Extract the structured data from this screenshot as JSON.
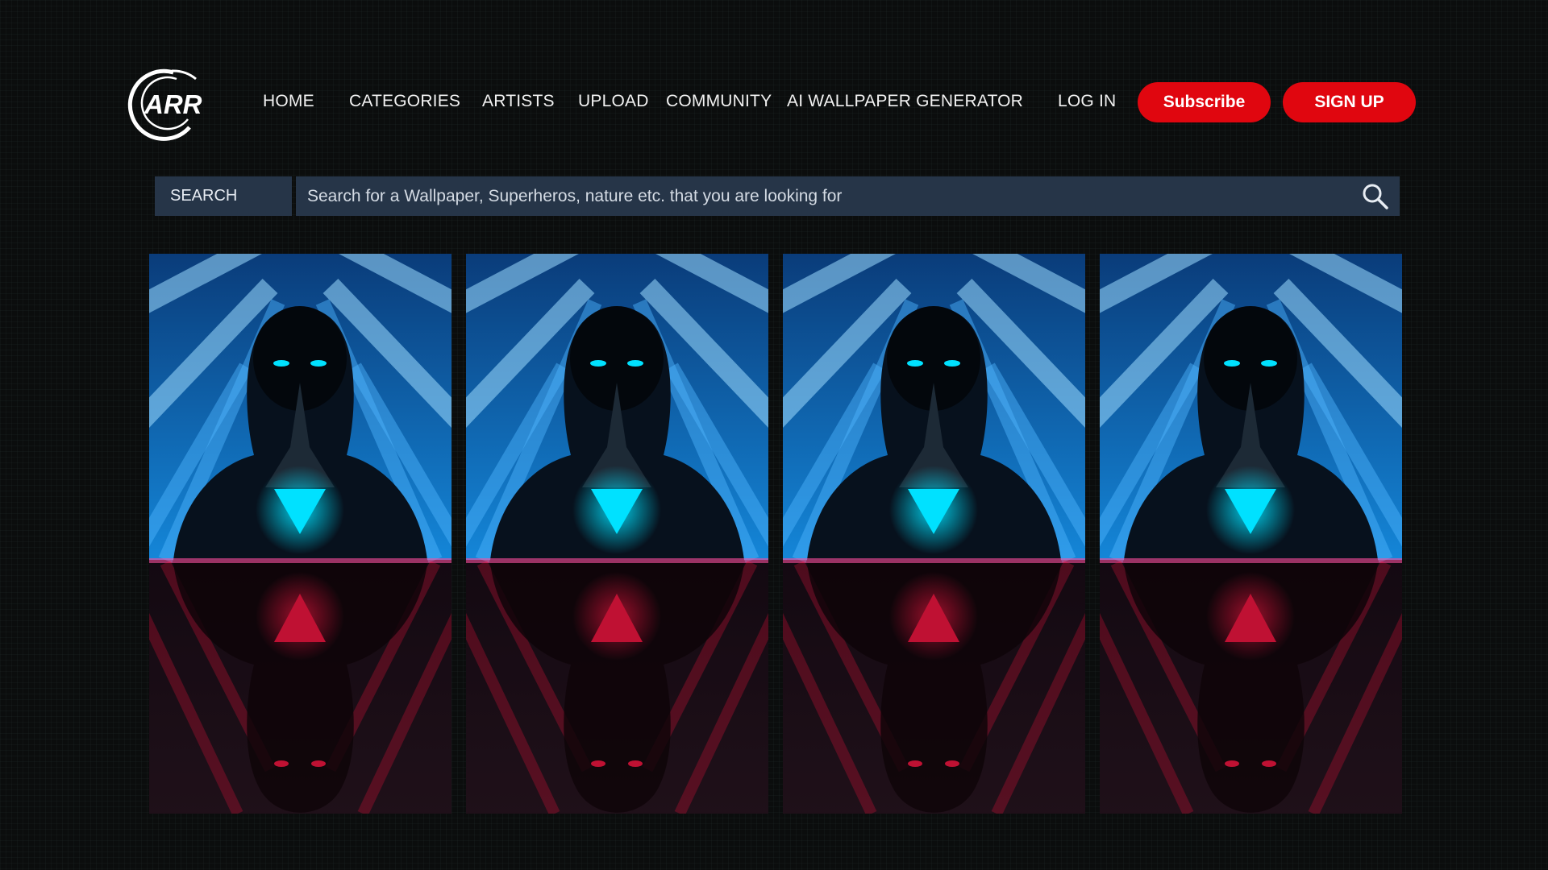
{
  "brand": {
    "logo_text": "ARR",
    "logo_icon": "ring-logo-icon"
  },
  "nav": {
    "items": [
      {
        "label": "HOME"
      },
      {
        "label": "CATEGORIES"
      },
      {
        "label": "ARTISTS"
      },
      {
        "label": "UPLOAD"
      },
      {
        "label": "COMMUNITY"
      },
      {
        "label": "AI WALLPAPER GENERATOR"
      }
    ],
    "login_label": "LOG IN",
    "subscribe_label": "Subscribe",
    "signup_label": "SIGN UP"
  },
  "search": {
    "label": "SEARCH",
    "placeholder": "Search for a Wallpaper, Superheros, nature etc. that you are looking for",
    "icon": "magnifier-icon"
  },
  "gallery": {
    "count_visible": 4,
    "thumbnail_subject": "hooded-figure-neon-triangle-wallpaper"
  },
  "colors": {
    "accent": "#e0060f",
    "search_bg": "#263548",
    "page_bg": "#0b0d0d",
    "neon_blue": "#00e1ff",
    "neon_red": "#ff1745"
  }
}
